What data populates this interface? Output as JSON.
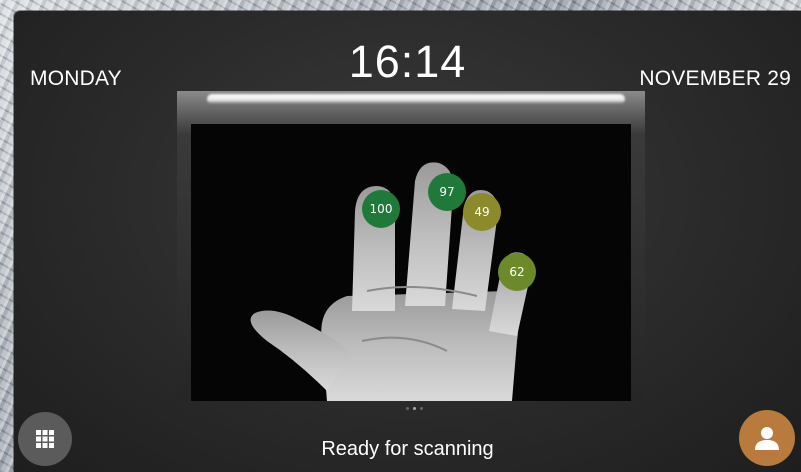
{
  "header": {
    "day": "MONDAY",
    "time": "16:14",
    "date": "NOVEMBER 29"
  },
  "scanner": {
    "finger_scores": [
      {
        "finger": "index",
        "value": "100",
        "color": "#1f7a3a"
      },
      {
        "finger": "middle",
        "value": "97",
        "color": "#1f7a3a"
      },
      {
        "finger": "ring",
        "value": "49",
        "color": "#8c8a2a"
      },
      {
        "finger": "little",
        "value": "62",
        "color": "#6d8a2a"
      }
    ],
    "page_indicator": {
      "pages": 3,
      "current": 2
    }
  },
  "footer": {
    "status_text": "Ready for scanning",
    "menu_icon": "grid-icon",
    "user_icon": "user-icon",
    "user_button_color": "#b87a3d"
  }
}
